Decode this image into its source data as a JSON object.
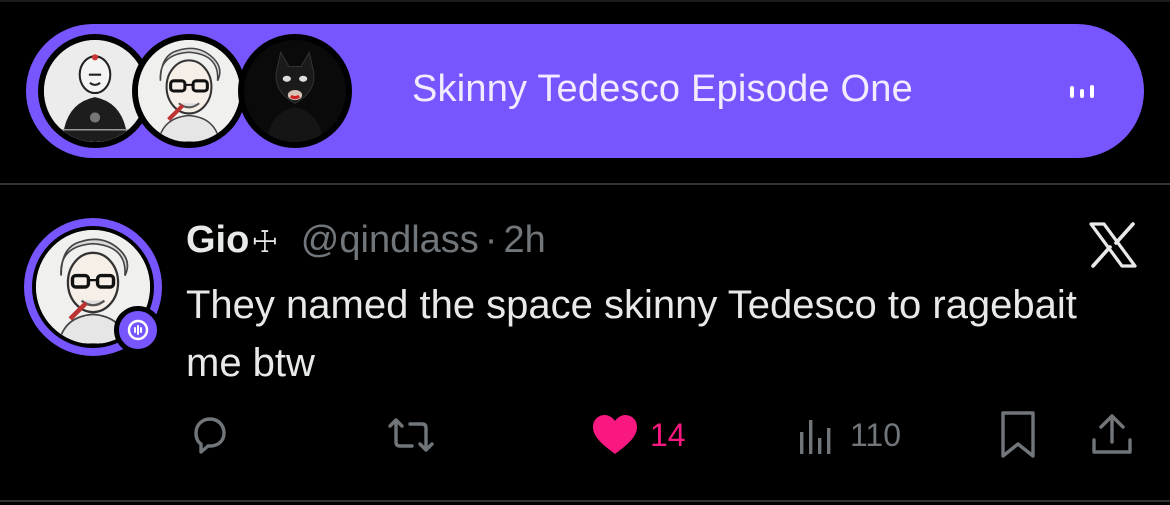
{
  "space": {
    "title": "Skinny Tedesco Episode One",
    "accent_color": "#7856ff",
    "speakers": [
      {
        "avatar": "bald-man-avatar"
      },
      {
        "avatar": "grey-haired-man-cigar-avatar"
      },
      {
        "avatar": "catwoman-avatar"
      }
    ],
    "live_icon": "audio-bars-icon"
  },
  "tweet": {
    "display_name": "Gio",
    "name_symbol": "☩",
    "handle": "@qindlass",
    "separator": "·",
    "time": "2h",
    "text": "They named the space skinny Tedesco to ragebait me btw",
    "avatar": "grey-haired-man-cigar-avatar",
    "host_badge_icon": "spaces-host-icon",
    "x_logo": "x-logo-icon"
  },
  "actions": {
    "reply": {
      "icon": "reply-icon"
    },
    "retweet": {
      "icon": "retweet-icon"
    },
    "like": {
      "icon": "heart-icon",
      "count": "14",
      "liked": true,
      "color": "#f91880"
    },
    "views": {
      "icon": "views-icon",
      "count": "110"
    },
    "bookmark": {
      "icon": "bookmark-icon"
    },
    "share": {
      "icon": "share-icon"
    }
  }
}
